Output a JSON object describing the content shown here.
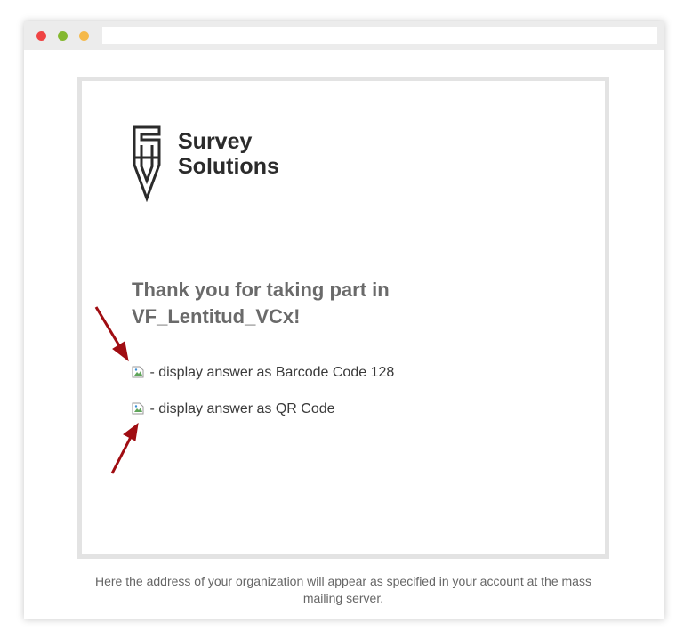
{
  "email": {
    "logo": {
      "line1": "Survey",
      "line2": "Solutions",
      "icon": "pen-nib-logo-icon"
    },
    "heading": "Thank you for taking part in VF_Lentitud_VCx!",
    "answers": [
      {
        "text": " - display answer as Barcode Code 128",
        "icon": "broken-image-icon"
      },
      {
        "text": " - display answer as QR Code",
        "icon": "broken-image-icon"
      }
    ],
    "footer": "Here the address of your organization will appear as specified in your account at the mass mailing server."
  },
  "annotations": {
    "arrow_icon": "red-arrow-icon",
    "arrow_color": "#a00d12"
  },
  "colors": {
    "traffic_red": "#ef4444",
    "traffic_green": "#84b82f",
    "traffic_yellow": "#f5b94a",
    "frame_border": "#e3e3e3",
    "heading": "#6a6a6a"
  }
}
